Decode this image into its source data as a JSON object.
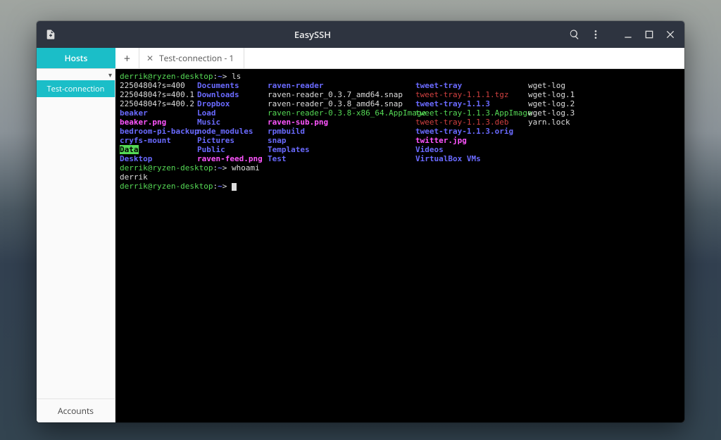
{
  "window": {
    "title": "EasySSH"
  },
  "tabbar": {
    "hosts_label": "Hosts",
    "tab_label": "Test-connection - 1"
  },
  "sidebar": {
    "item": "Test-connection",
    "accounts": "Accounts"
  },
  "terminal": {
    "prompt_user": "derrik@ryzen-desktop",
    "cmd_ls": "ls",
    "cmd_whoami": "whoami",
    "whoami_out": "derrik",
    "ls_rows": [
      [
        {
          "t": "22504804?s=400",
          "c": "term-white"
        },
        {
          "t": "Documents",
          "c": "term-blue"
        },
        {
          "t": "raven-reader",
          "c": "term-blue"
        },
        {
          "t": "tweet-tray",
          "c": "term-blue"
        },
        {
          "t": "wget-log",
          "c": "term-white"
        }
      ],
      [
        {
          "t": "22504804?s=400.1",
          "c": "term-white"
        },
        {
          "t": "Downloads",
          "c": "term-blue"
        },
        {
          "t": "raven-reader_0.3.7_amd64.snap",
          "c": "term-white"
        },
        {
          "t": "tweet-tray-1.1.1.tgz",
          "c": "term-red"
        },
        {
          "t": "wget-log.1",
          "c": "term-white"
        }
      ],
      [
        {
          "t": "22504804?s=400.2",
          "c": "term-white"
        },
        {
          "t": "Dropbox",
          "c": "term-blue"
        },
        {
          "t": "raven-reader_0.3.8_amd64.snap",
          "c": "term-white"
        },
        {
          "t": "tweet-tray-1.1.3",
          "c": "term-blue"
        },
        {
          "t": "wget-log.2",
          "c": "term-white"
        }
      ],
      [
        {
          "t": "beaker",
          "c": "term-blue"
        },
        {
          "t": "Load",
          "c": "term-blue"
        },
        {
          "t": "raven-reader-0.3.8-x86_64.AppImage",
          "c": "term-green"
        },
        {
          "t": "tweet-tray-1.1.3.AppImage",
          "c": "term-green"
        },
        {
          "t": "wget-log.3",
          "c": "term-white"
        }
      ],
      [
        {
          "t": "beaker.png",
          "c": "term-mag"
        },
        {
          "t": "Music",
          "c": "term-blue"
        },
        {
          "t": "raven-sub.png",
          "c": "term-mag"
        },
        {
          "t": "tweet-tray-1.1.3.deb",
          "c": "term-red"
        },
        {
          "t": "yarn.lock",
          "c": "term-white"
        }
      ],
      [
        {
          "t": "bedroom-pi-backup",
          "c": "term-blue"
        },
        {
          "t": "node_modules",
          "c": "term-blue"
        },
        {
          "t": "rpmbuild",
          "c": "term-blue"
        },
        {
          "t": "tweet-tray-1.1.3.orig",
          "c": "term-blue"
        },
        {
          "t": "",
          "c": ""
        }
      ],
      [
        {
          "t": "cryfs-mount",
          "c": "term-blue"
        },
        {
          "t": "Pictures",
          "c": "term-blue"
        },
        {
          "t": "snap",
          "c": "term-blue"
        },
        {
          "t": "twitter.jpg",
          "c": "term-mag"
        },
        {
          "t": "",
          "c": ""
        }
      ],
      [
        {
          "t": "Data",
          "c": "term-gsel"
        },
        {
          "t": "Public",
          "c": "term-blue"
        },
        {
          "t": "Templates",
          "c": "term-blue"
        },
        {
          "t": "Videos",
          "c": "term-blue"
        },
        {
          "t": "",
          "c": ""
        }
      ],
      [
        {
          "t": "Desktop",
          "c": "term-blue"
        },
        {
          "t": "raven-feed.png",
          "c": "term-mag"
        },
        {
          "t": "Test",
          "c": "term-blue"
        },
        {
          "t": "VirtualBox VMs",
          "c": "term-blue"
        },
        {
          "t": "",
          "c": ""
        }
      ]
    ]
  }
}
